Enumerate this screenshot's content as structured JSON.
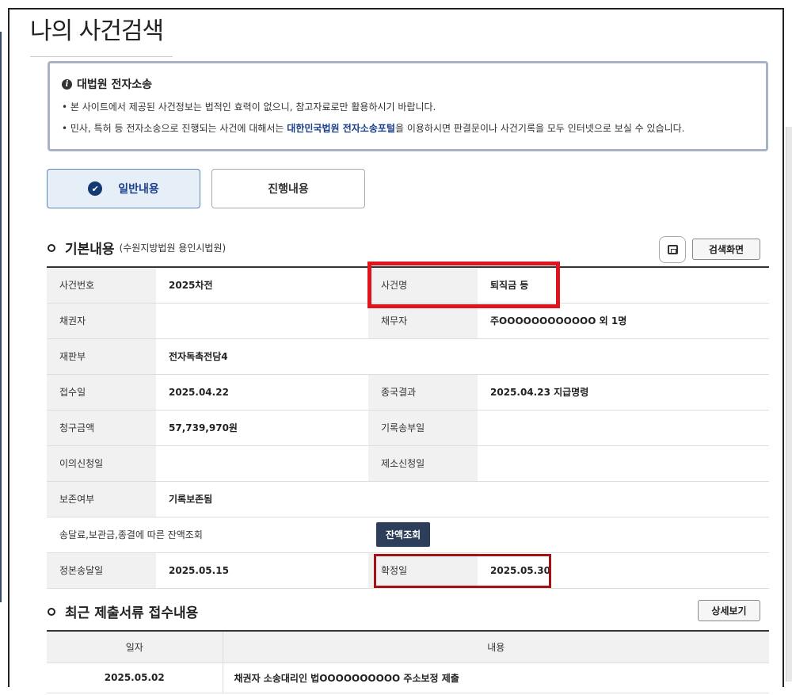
{
  "page": {
    "title": "나의 사건검색"
  },
  "notice": {
    "heading": "대법원 전자소송",
    "line1": "• 본 사이트에서 제공된 사건정보는 법적인 효력이 없으니, 참고자료로만 활용하시기 바랍니다.",
    "line2_prefix": "• 민사, 특허 등 전자소송으로 진행되는 사건에 대해서는 ",
    "line2_link": "대한민국법원 전자소송포털",
    "line2_suffix": "을 이용하시면 판결문이나 사건기록을 모두 인터넷으로 보실 수 있습니다."
  },
  "tabs": [
    {
      "label": "일반내용",
      "active": true
    },
    {
      "label": "진행내용",
      "active": false
    }
  ],
  "basic": {
    "title": "기본내용",
    "court": "(수원지방법원 용인시법원)",
    "search_screen_button": "검색화면",
    "rows": [
      {
        "l1": "사건번호",
        "v1": "2025차전",
        "l2": "사건명",
        "v2": "퇴직금 등"
      },
      {
        "l1": "채권자",
        "v1": "",
        "l2": "채무자",
        "v2": "주OOOOOOOOOOOO 외 1명"
      },
      {
        "l1": "재판부",
        "v1": "전자독촉전담4"
      },
      {
        "l1": "접수일",
        "v1": "2025.04.22",
        "l2": "종국결과",
        "v2": "2025.04.23 지급명령"
      },
      {
        "l1": "청구금액",
        "v1": "57,739,970원",
        "l2": "기록송부일",
        "v2": ""
      },
      {
        "l1": "이의신청일",
        "v1": "",
        "l2": "제소신청일",
        "v2": ""
      },
      {
        "l1": "보존여부",
        "v1": "기록보존됨"
      },
      {
        "l1": "송달료,보관금,종결에 따른 잔액조회",
        "button": "잔액조회"
      },
      {
        "l1": "정본송달일",
        "v1": "2025.05.15",
        "l2": "확정일",
        "v2": "2025.05.30"
      }
    ]
  },
  "recent": {
    "title": "최근 제출서류 접수내용",
    "detail_button": "상세보기",
    "headers": [
      "일자",
      "내용"
    ],
    "rows": [
      {
        "date": "2025.05.02",
        "content": "채권자 소송대리인 법OOOOOOOOOO 주소보정 제출"
      }
    ]
  },
  "colors": {
    "accent": "#143a73",
    "highlight_red": "#e1141e",
    "highlight_dark": "#a01418"
  }
}
